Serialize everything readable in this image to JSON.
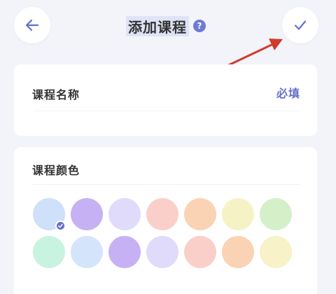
{
  "header": {
    "title": "添加课程",
    "help_glyph": "?",
    "back_icon": "arrow-left-icon",
    "confirm_icon": "checkmark-icon",
    "accent_color": "#6571c9",
    "annotation_arrow_color": "#d23b2c"
  },
  "name_section": {
    "label": "课程名称",
    "required_text": "必填"
  },
  "color_section": {
    "label": "课程颜色",
    "selected_index": 0,
    "colors": [
      "#cfe0fb",
      "#c5b1f3",
      "#e0dafb",
      "#fbcfc9",
      "#fad2b4",
      "#f5f3c5",
      "#d4f0c9",
      "#c9f3e1",
      "#d4e4fb",
      "#c5b1f3",
      "#e0dafb",
      "#fbcfc9",
      "#fad2b4",
      "#f8f2c8"
    ]
  }
}
